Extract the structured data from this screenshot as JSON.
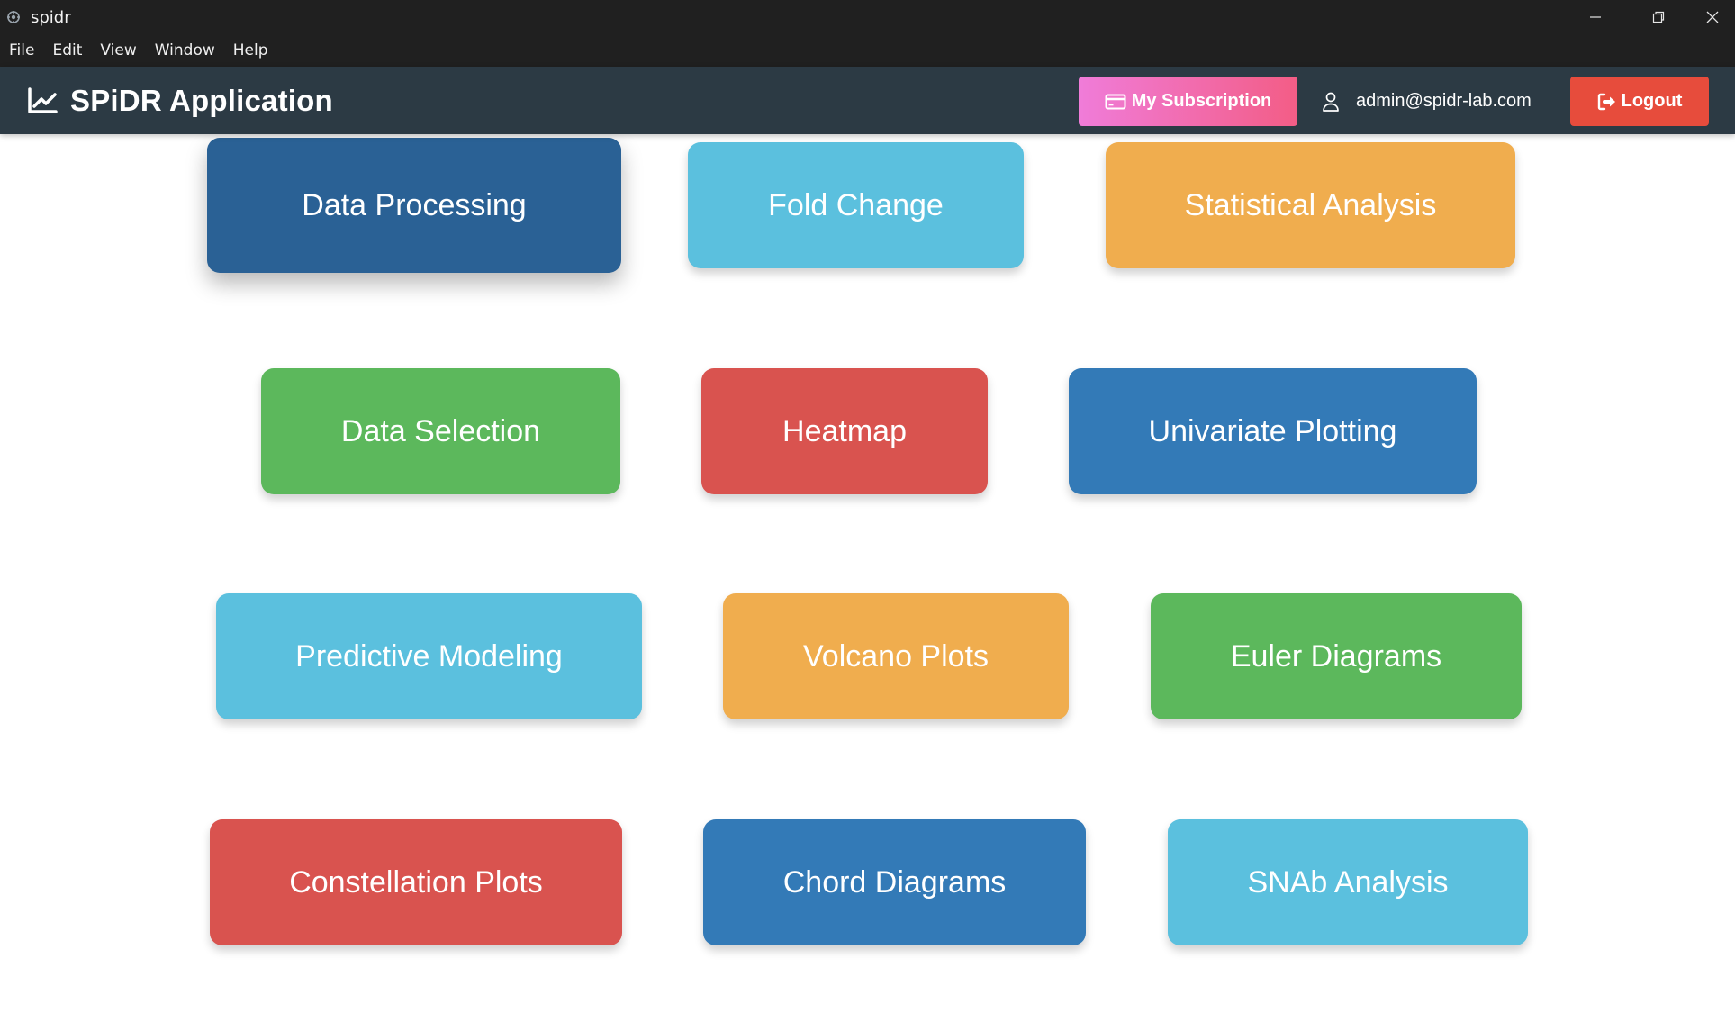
{
  "window": {
    "title": "spidr"
  },
  "menubar": {
    "items": [
      "File",
      "Edit",
      "View",
      "Window",
      "Help"
    ]
  },
  "header": {
    "brand": "SPiDR Application",
    "subscription_label": "My Subscription",
    "user_email": "admin@spidr-lab.com",
    "logout_label": "Logout"
  },
  "modules": [
    {
      "label": "Data Processing",
      "color": "#2a6195"
    },
    {
      "label": "Fold Change",
      "color": "#5bc0de"
    },
    {
      "label": "Statistical Analysis",
      "color": "#f0ad4e"
    },
    {
      "label": "Data Selection",
      "color": "#5cb85c"
    },
    {
      "label": "Heatmap",
      "color": "#d9534f"
    },
    {
      "label": "Univariate Plotting",
      "color": "#337ab7"
    },
    {
      "label": "Predictive Modeling",
      "color": "#5bc0de"
    },
    {
      "label": "Volcano Plots",
      "color": "#f0ad4e"
    },
    {
      "label": "Euler Diagrams",
      "color": "#5cb85c"
    },
    {
      "label": "Constellation Plots",
      "color": "#d9534f"
    },
    {
      "label": "Chord Diagrams",
      "color": "#337ab7"
    },
    {
      "label": "SNAb Analysis",
      "color": "#5bc0de"
    }
  ]
}
